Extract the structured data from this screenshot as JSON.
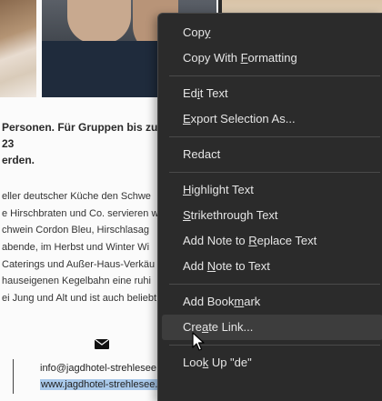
{
  "document": {
    "para1_lines": [
      "Personen. Für Gruppen bis zu 23",
      "erden."
    ],
    "para2_lines": [
      "eller deutscher Küche den Schwe",
      "e Hirschbraten und Co. servieren w",
      "chwein Cordon Bleu, Hirschlasag",
      "abende, im Herbst und Winter Wi",
      "Caterings und Außer-Haus-Verkäu",
      "hauseigenen Kegelbahn eine ruhi",
      "ei Jung und Alt und ist auch beliebt"
    ],
    "email": "info@jagdhotel-strehlesee.",
    "website": "www.jagdhotel-strehlesee.de",
    "mail_icon": "envelope-icon"
  },
  "context_menu": {
    "items": {
      "copy": {
        "pre": "Cop",
        "ul": "y",
        "post": ""
      },
      "copy_formatting": {
        "pre": "Copy With ",
        "ul": "F",
        "post": "ormatting"
      },
      "edit_text": {
        "pre": "Ed",
        "ul": "i",
        "post": "t Text"
      },
      "export_selection": {
        "pre": "",
        "ul": "E",
        "post": "xport Selection As..."
      },
      "redact": {
        "pre": "Redact",
        "ul": "",
        "post": ""
      },
      "highlight_text": {
        "pre": "",
        "ul": "H",
        "post": "ighlight Text"
      },
      "strikethrough_text": {
        "pre": "",
        "ul": "S",
        "post": "trikethrough Text"
      },
      "note_replace": {
        "pre": "Add Note to ",
        "ul": "R",
        "post": "eplace Text"
      },
      "note_to_text": {
        "pre": "Add ",
        "ul": "N",
        "post": "ote to Text"
      },
      "add_bookmark": {
        "pre": "Add Book",
        "ul": "m",
        "post": "ark"
      },
      "create_link": {
        "pre": "Cre",
        "ul": "a",
        "post": "te Link..."
      },
      "look_up": {
        "pre": "Loo",
        "ul": "k",
        "post": " Up \"de\""
      }
    }
  },
  "colors": {
    "menu_background": "#2b2b2b",
    "menu_hover": "#3d3d3d",
    "menu_text": "#e6e6e6",
    "selection_highlight": "#a9c9ea"
  },
  "cursor_icon": "arrow-pointer-icon"
}
